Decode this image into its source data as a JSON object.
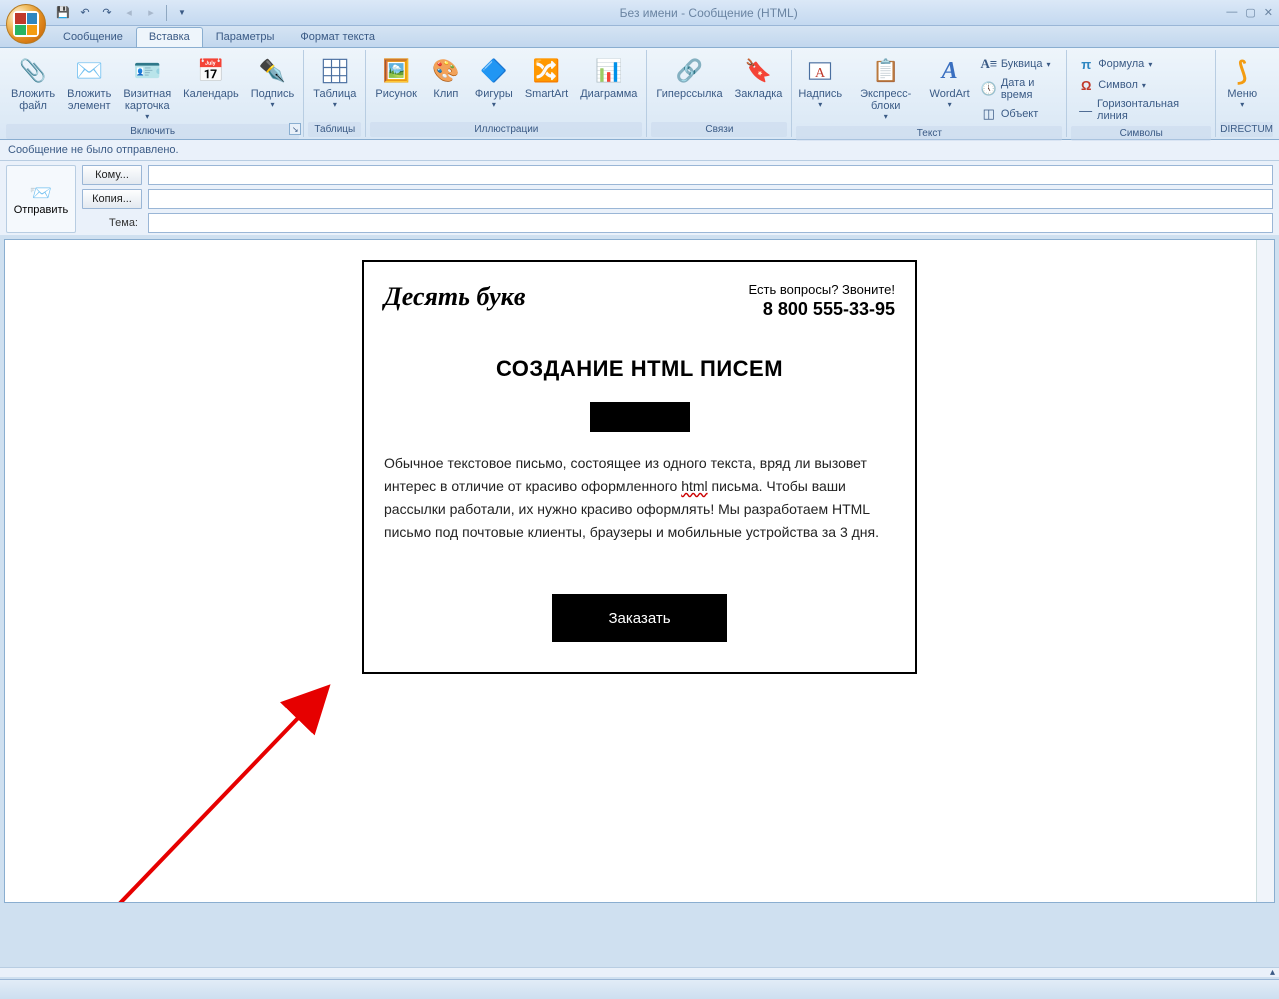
{
  "window": {
    "title": "Без имени - Сообщение (HTML)"
  },
  "tabs": {
    "message": "Сообщение",
    "insert": "Вставка",
    "params": "Параметры",
    "format": "Формат текста"
  },
  "ribbon": {
    "include": {
      "label": "Включить",
      "attach_file": "Вложить\nфайл",
      "attach_item": "Вложить\nэлемент",
      "business_card": "Визитная\nкарточка",
      "calendar": "Календарь",
      "signature": "Подпись"
    },
    "tables": {
      "label": "Таблицы",
      "table": "Таблица"
    },
    "illustrations": {
      "label": "Иллюстрации",
      "picture": "Рисунок",
      "clip": "Клип",
      "shapes": "Фигуры",
      "smartart": "SmartArt",
      "chart": "Диаграмма"
    },
    "links": {
      "label": "Связи",
      "hyperlink": "Гиперссылка",
      "bookmark": "Закладка"
    },
    "text": {
      "label": "Текст",
      "textbox": "Надпись",
      "quickparts": "Экспресс-блоки",
      "wordart": "WordArt",
      "dropcap": "Буквица",
      "datetime": "Дата и время",
      "object": "Объект"
    },
    "symbols": {
      "label": "Символы",
      "equation": "Формула",
      "symbol": "Символ",
      "hr": "Горизонтальная линия"
    },
    "directum": {
      "label": "DIRECTUM",
      "menu": "Меню"
    }
  },
  "infobar": "Сообщение не было отправлено.",
  "compose": {
    "send": "Отправить",
    "to": "Кому...",
    "cc": "Копия...",
    "subject": "Тема:"
  },
  "email": {
    "brand": "Десять букв",
    "question": "Есть вопросы? Звоните!",
    "phone": "8 800 555-33-95",
    "heading": "СОЗДАНИЕ HTML ПИСЕМ",
    "body_p1": "Обычное текстовое письмо, состоящее из одного текста, вряд ли вызовет интерес в отличие от красиво оформленного ",
    "body_html": "html",
    "body_p2": " письма. Чтобы ваши рассылки работали, их нужно красиво оформлять! Мы разработаем HTML письмо под почтовые клиенты, браузеры и мобильные устройства за 3 дня.",
    "order": "Заказать"
  }
}
